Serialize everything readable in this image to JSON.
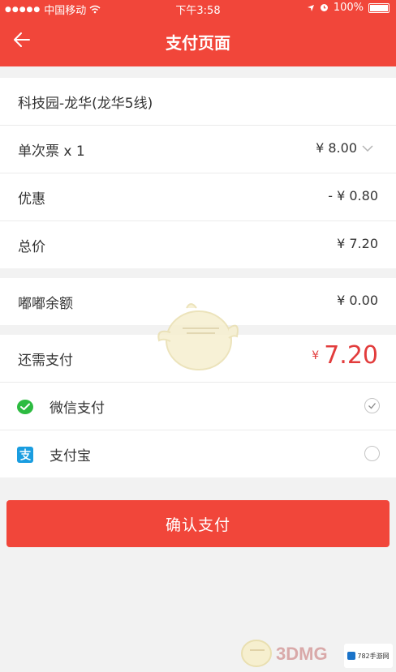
{
  "status_bar": {
    "carrier": "中国移动",
    "time": "下午3:58",
    "battery": "100%"
  },
  "nav": {
    "title": "支付页面",
    "back_icon": "back-arrow-icon"
  },
  "route": "科技园-龙华(龙华5线)",
  "ticket": {
    "label": "单次票 x 1",
    "price": "¥ 8.00"
  },
  "discount": {
    "label": "优惠",
    "value": "- ¥ 0.80"
  },
  "total": {
    "label": "总价",
    "value": "¥ 7.20"
  },
  "balance": {
    "label": "嘟嘟余额",
    "value": "¥ 0.00"
  },
  "due": {
    "label": "还需支付",
    "currency": "¥",
    "amount": "7.20"
  },
  "payment_methods": [
    {
      "label": "微信支付",
      "icon": "wechat-pay-icon",
      "selected": true
    },
    {
      "label": "支付宝",
      "icon": "alipay-icon",
      "selected": false
    }
  ],
  "confirm_button": "确认支付",
  "colors": {
    "brand": "#f1463a",
    "amount": "#e23c3c",
    "wechat": "#2dbb41",
    "alipay": "#1a9de0"
  },
  "watermark": {
    "text": "3DMG",
    "site": "782手游网"
  }
}
